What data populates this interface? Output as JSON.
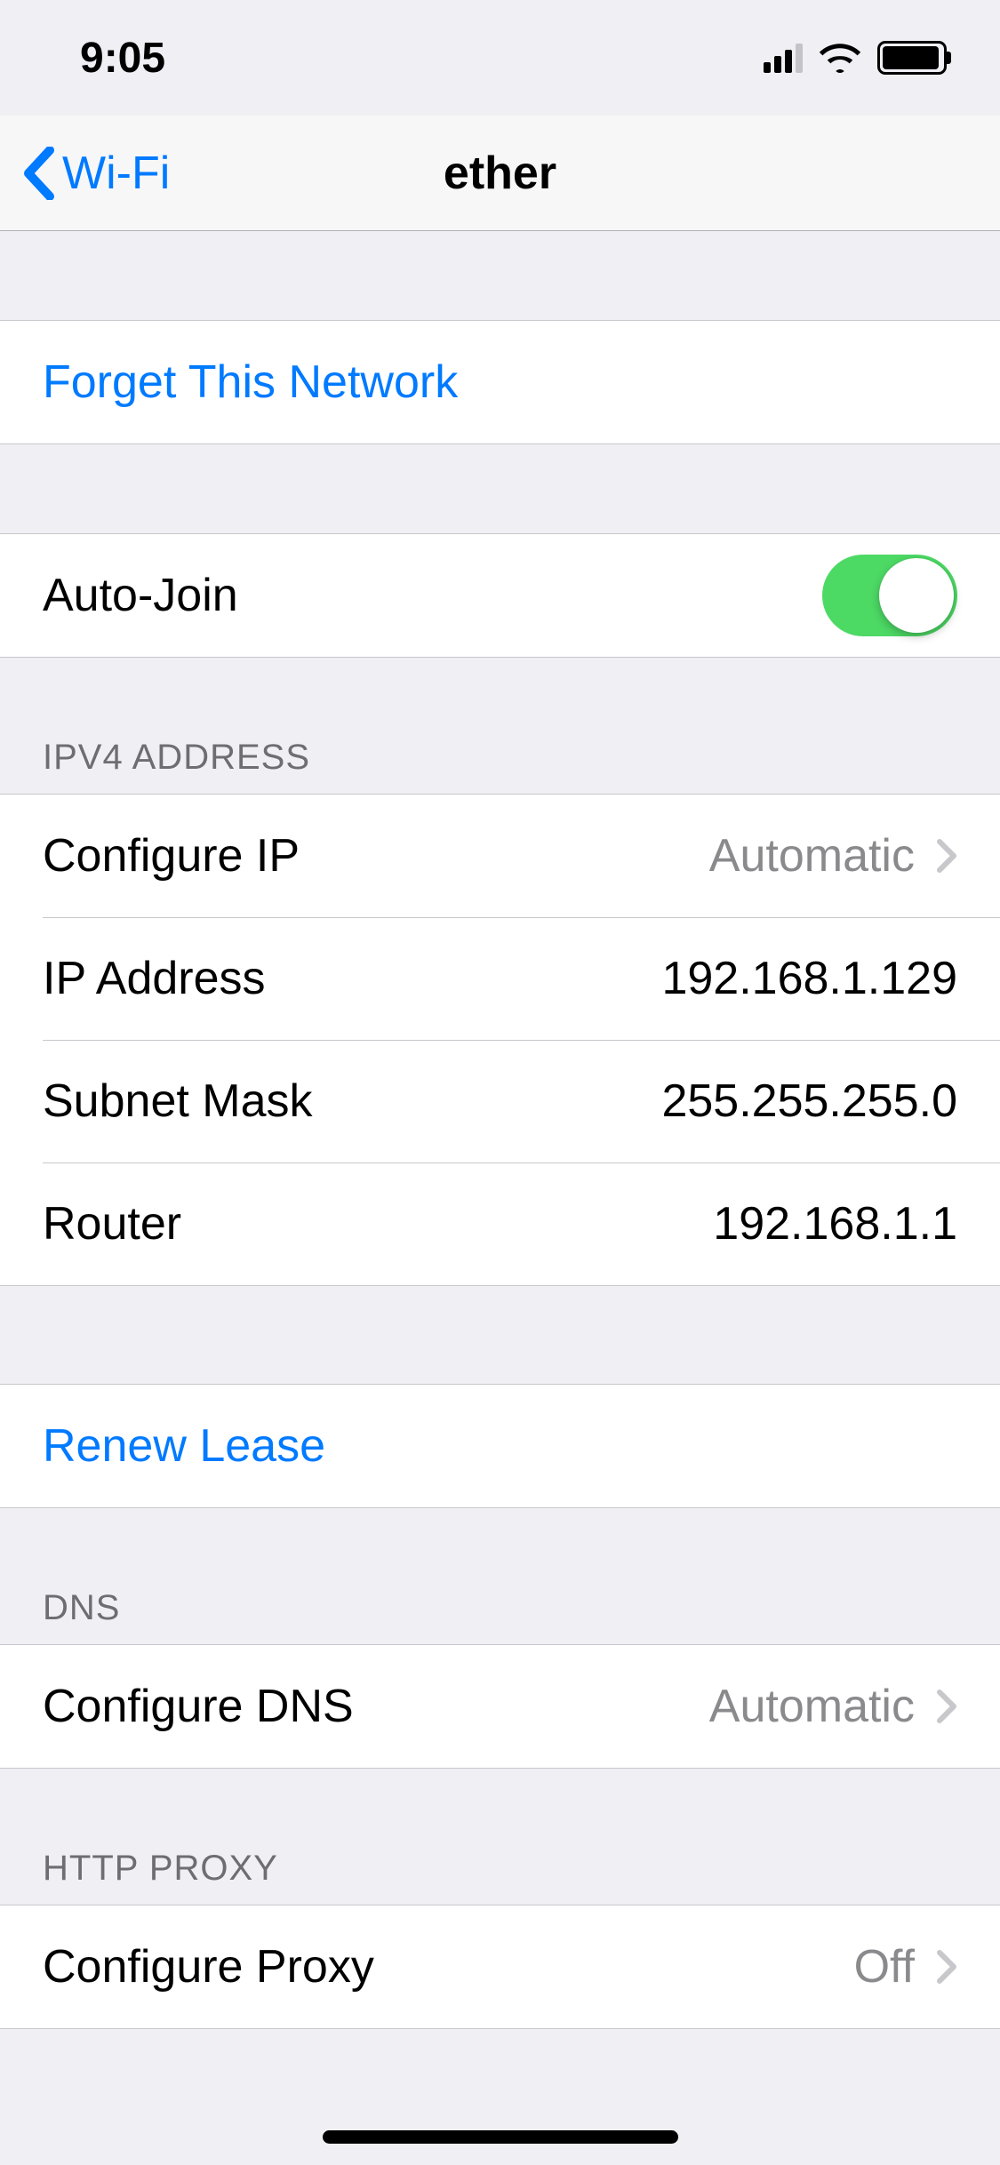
{
  "status": {
    "time": "9:05"
  },
  "nav": {
    "back_label": "Wi-Fi",
    "title": "ether"
  },
  "forget": {
    "label": "Forget This Network"
  },
  "auto_join": {
    "label": "Auto-Join",
    "on": true
  },
  "ipv4": {
    "header": "IPV4 ADDRESS",
    "configure_ip_label": "Configure IP",
    "configure_ip_value": "Automatic",
    "ip_address_label": "IP Address",
    "ip_address_value": "192.168.1.129",
    "subnet_label": "Subnet Mask",
    "subnet_value": "255.255.255.0",
    "router_label": "Router",
    "router_value": "192.168.1.1"
  },
  "renew": {
    "label": "Renew Lease"
  },
  "dns": {
    "header": "DNS",
    "configure_label": "Configure DNS",
    "configure_value": "Automatic"
  },
  "proxy": {
    "header": "HTTP PROXY",
    "configure_label": "Configure Proxy",
    "configure_value": "Off"
  }
}
